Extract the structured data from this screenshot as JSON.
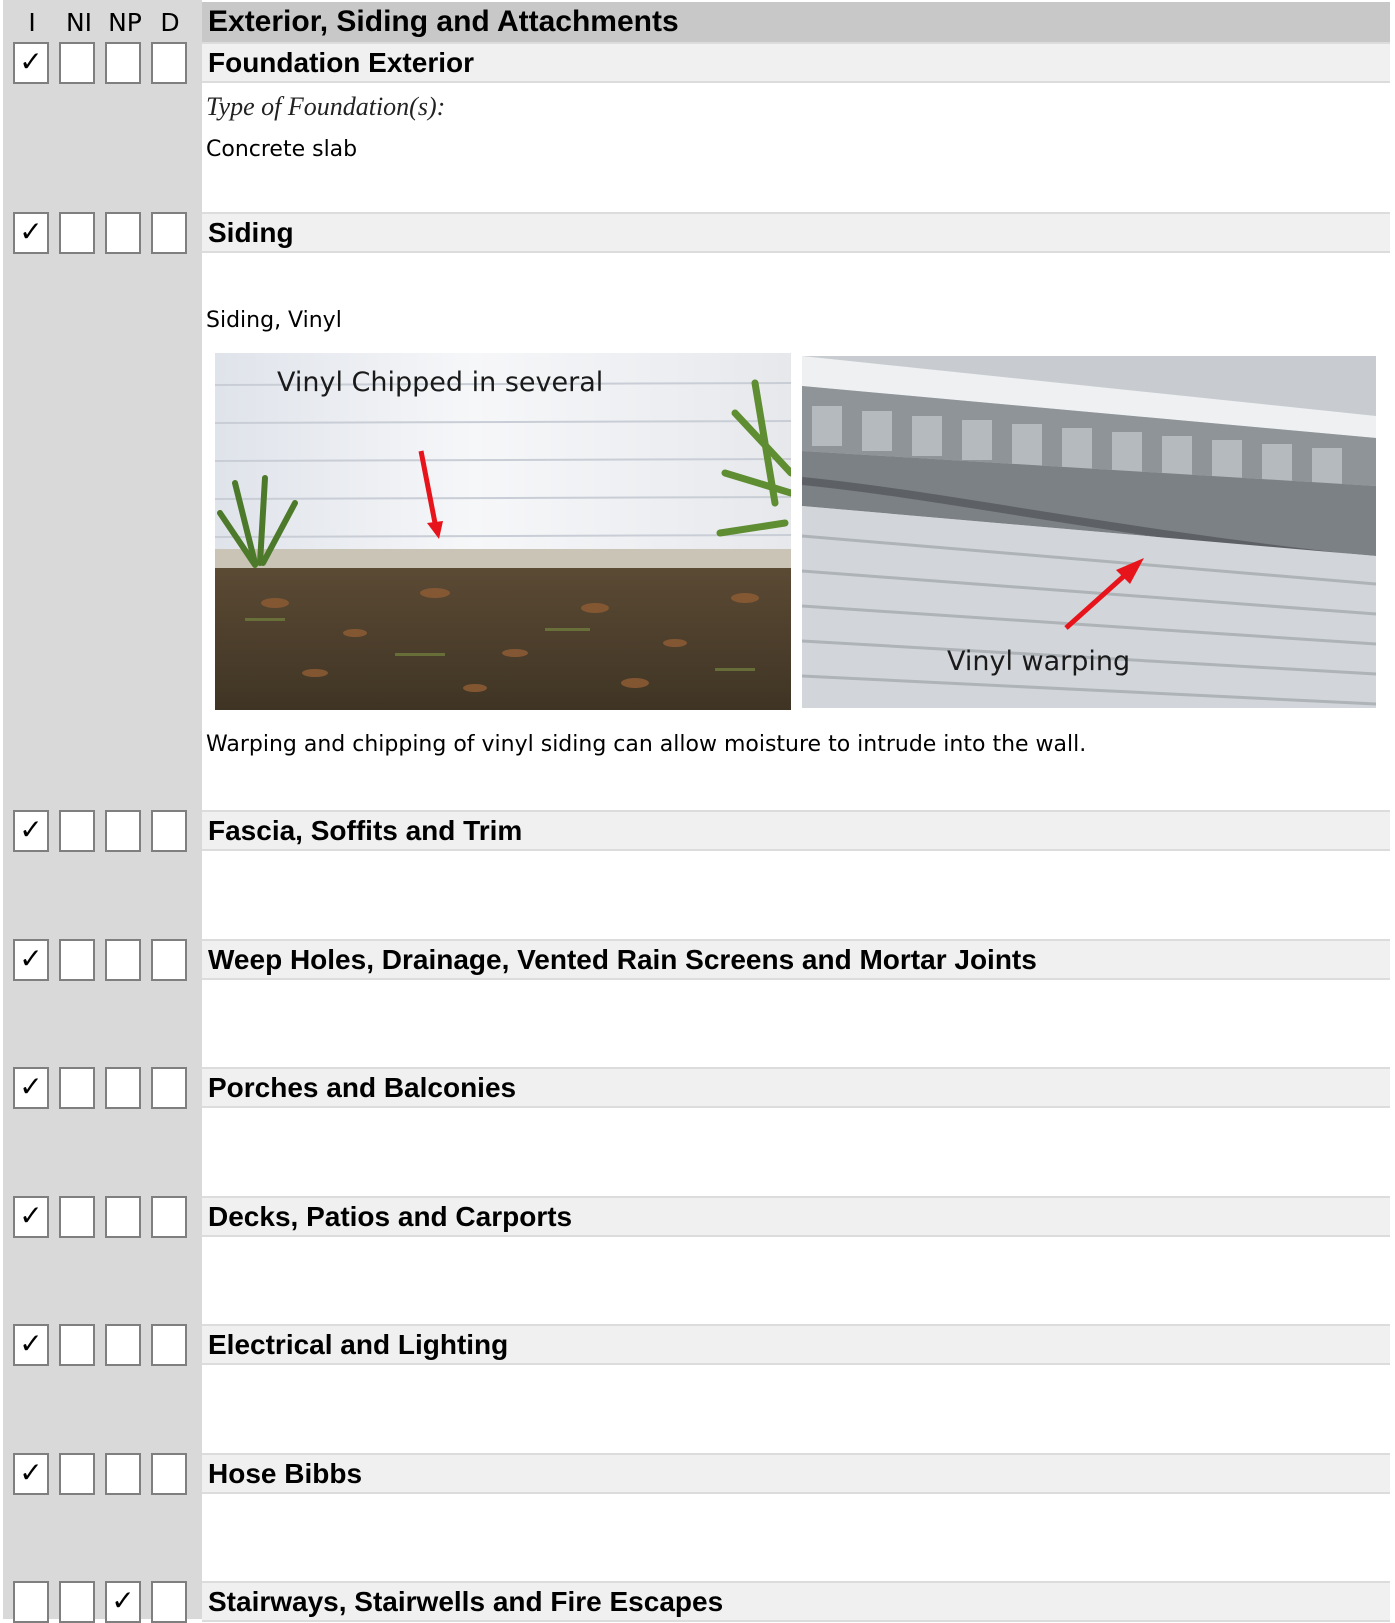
{
  "column_headers": [
    "I",
    "NI",
    "NP",
    "D"
  ],
  "page_title": "Exterior, Siding and Attachments",
  "check_mark": "✓",
  "sections": [
    {
      "name": "Foundation Exterior",
      "checks": [
        true,
        false,
        false,
        false
      ]
    },
    {
      "name": "Siding",
      "checks": [
        true,
        false,
        false,
        false
      ]
    },
    {
      "name": "Fascia, Soffits and Trim",
      "checks": [
        true,
        false,
        false,
        false
      ]
    },
    {
      "name": "Weep Holes, Drainage, Vented Rain Screens and Mortar Joints",
      "checks": [
        true,
        false,
        false,
        false
      ]
    },
    {
      "name": "Porches and Balconies",
      "checks": [
        true,
        false,
        false,
        false
      ]
    },
    {
      "name": "Decks, Patios and Carports",
      "checks": [
        true,
        false,
        false,
        false
      ]
    },
    {
      "name": "Electrical and Lighting",
      "checks": [
        true,
        false,
        false,
        false
      ]
    },
    {
      "name": "Hose Bibbs",
      "checks": [
        true,
        false,
        false,
        false
      ]
    },
    {
      "name": "Stairways, Stairwells and Fire Escapes",
      "checks": [
        false,
        false,
        true,
        false
      ]
    }
  ],
  "foundation": {
    "type_label": "Type of Foundation(s):",
    "type_value": "Concrete slab"
  },
  "siding": {
    "material": "Siding, Vinyl",
    "photo_1_caption": "Vinyl Chipped in several",
    "photo_2_caption": "Vinyl warping",
    "comment": "Warping and chipping of vinyl siding can allow moisture to intrude into the wall.",
    "arrow_color": "#e8141c"
  }
}
